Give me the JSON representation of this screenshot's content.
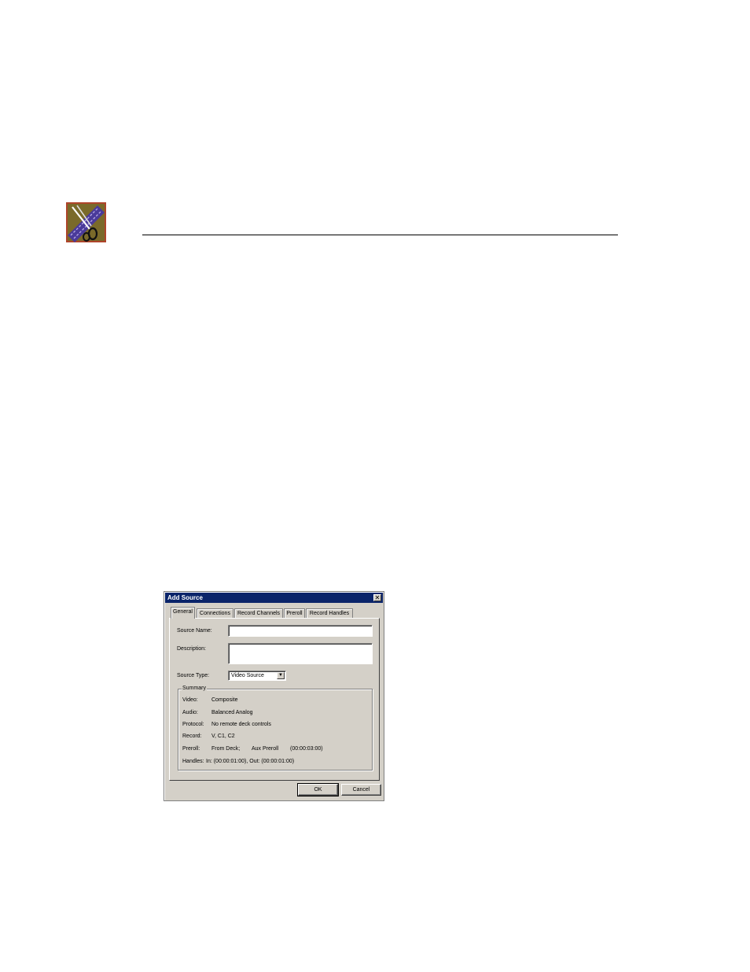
{
  "dialog": {
    "title": "Add Source",
    "close_glyph": "✕",
    "tabs": [
      {
        "label": "General",
        "active": true
      },
      {
        "label": "Connections",
        "active": false
      },
      {
        "label": "Record Channels",
        "active": false
      },
      {
        "label": "Preroll",
        "active": false
      },
      {
        "label": "Record Handles",
        "active": false
      }
    ],
    "general": {
      "source_name_label": "Source Name:",
      "source_name_value": "",
      "description_label": "Description:",
      "description_value": "",
      "source_type_label": "Source Type:",
      "source_type_value": "Video Source",
      "dropdown_glyph": "▼"
    },
    "summary": {
      "title": "Summary",
      "rows": [
        {
          "key": "Video:",
          "value": "Composite"
        },
        {
          "key": "Audio:",
          "value": "Balanced Analog"
        },
        {
          "key": "Protocol:",
          "value": "No remote deck controls"
        },
        {
          "key": "Record:",
          "value": "V, C1, C2"
        },
        {
          "key": "Preroll:",
          "value": "From Deck;",
          "value2": "Aux Preroll",
          "value3": "(00:00:03:00)"
        },
        {
          "key": "Handles:",
          "value": "In: (00:00:01:00), Out: (00:00:01:00)"
        }
      ]
    },
    "buttons": {
      "ok": "OK",
      "cancel": "Cancel"
    }
  },
  "colors": {
    "titlebar": "#0a246a",
    "dialog_face": "#d4d0c8"
  },
  "icons": {
    "logo": "film-scissors-logo-icon"
  }
}
